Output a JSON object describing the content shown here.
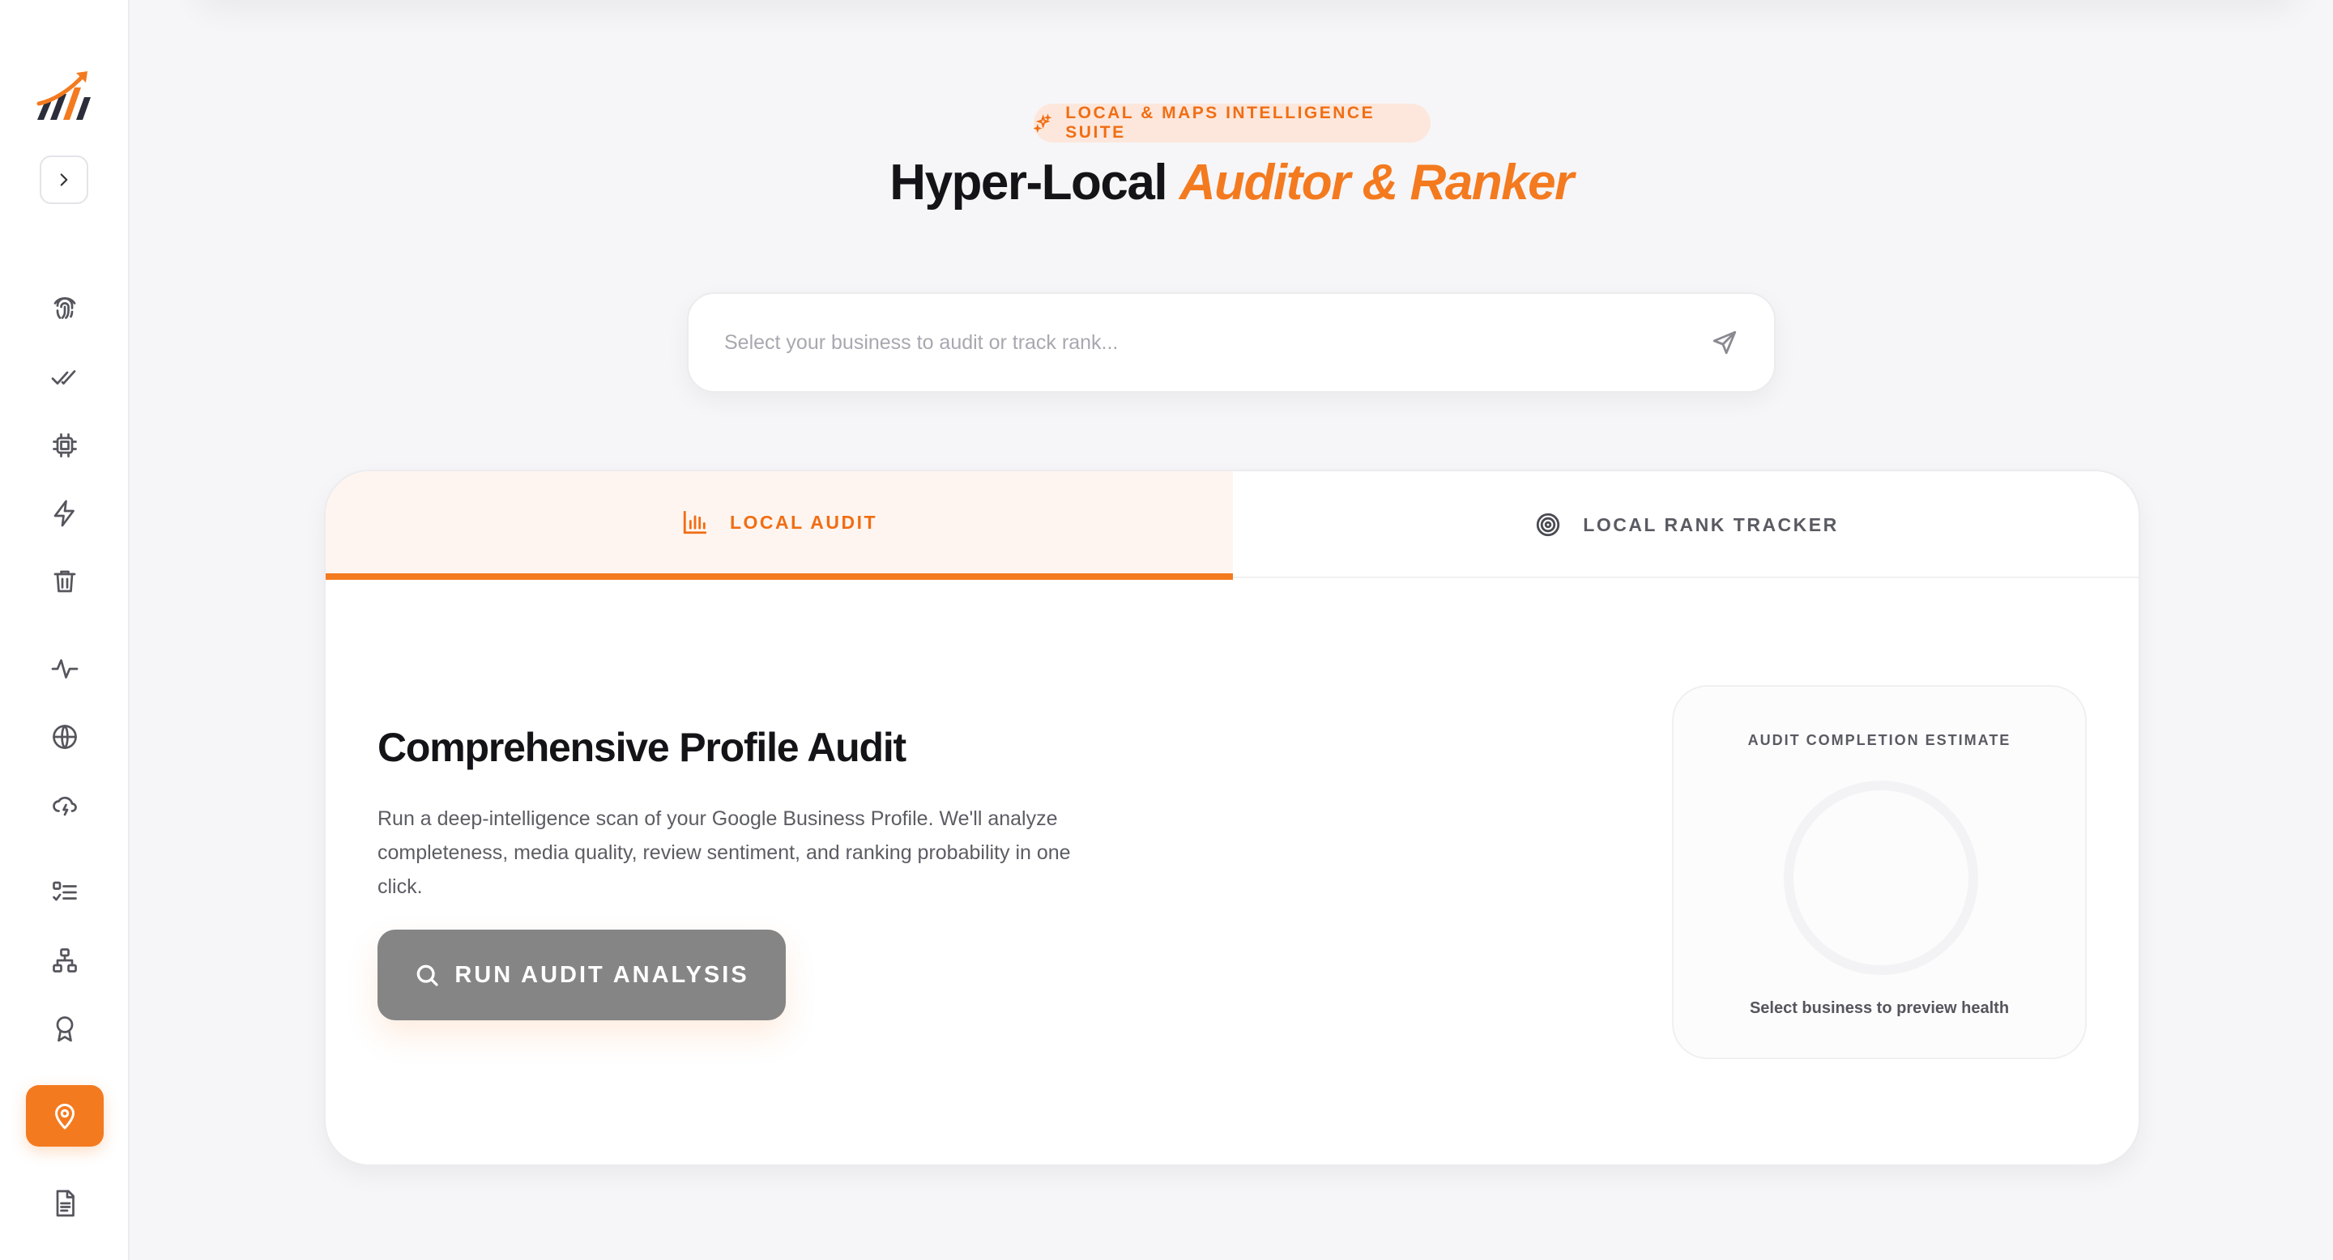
{
  "sidebar": {
    "logo": "growth-chart-logo",
    "collapse_icon": "chevron-right-icon",
    "nav": [
      {
        "icon": "fingerprint-icon"
      },
      {
        "icon": "double-check-icon"
      },
      {
        "icon": "cpu-chip-icon"
      },
      {
        "icon": "lightning-icon"
      },
      {
        "icon": "trash-icon"
      },
      {
        "icon": "activity-pulse-icon"
      },
      {
        "icon": "globe-icon"
      },
      {
        "icon": "cloud-lightning-icon"
      },
      {
        "icon": "checklist-icon"
      },
      {
        "icon": "sitemap-icon"
      },
      {
        "icon": "award-icon"
      },
      {
        "icon": "map-pin-icon",
        "active": true
      },
      {
        "icon": "document-icon"
      }
    ]
  },
  "hero": {
    "badge": "LOCAL & MAPS INTELLIGENCE SUITE",
    "title_plain": "Hyper-Local ",
    "title_accent": "Auditor & Ranker"
  },
  "search": {
    "placeholder": "Select your business to audit or track rank...",
    "value": ""
  },
  "tabs": [
    {
      "label": "LOCAL AUDIT",
      "icon": "bar-chart-icon",
      "active": true
    },
    {
      "label": "LOCAL RANK TRACKER",
      "icon": "target-icon",
      "active": false
    }
  ],
  "audit": {
    "title": "Comprehensive Profile Audit",
    "description": "Run a deep-intelligence scan of your Google Business Profile. We'll analyze completeness, media quality, review sentiment, and ranking probability in one click.",
    "button_label": "RUN AUDIT ANALYSIS"
  },
  "estimate": {
    "label": "AUDIT COMPLETION ESTIMATE",
    "note": "Select business to preview health"
  },
  "colors": {
    "accent": "#f47a1f",
    "button_disabled": "#858585",
    "background": "#f6f6f8"
  }
}
